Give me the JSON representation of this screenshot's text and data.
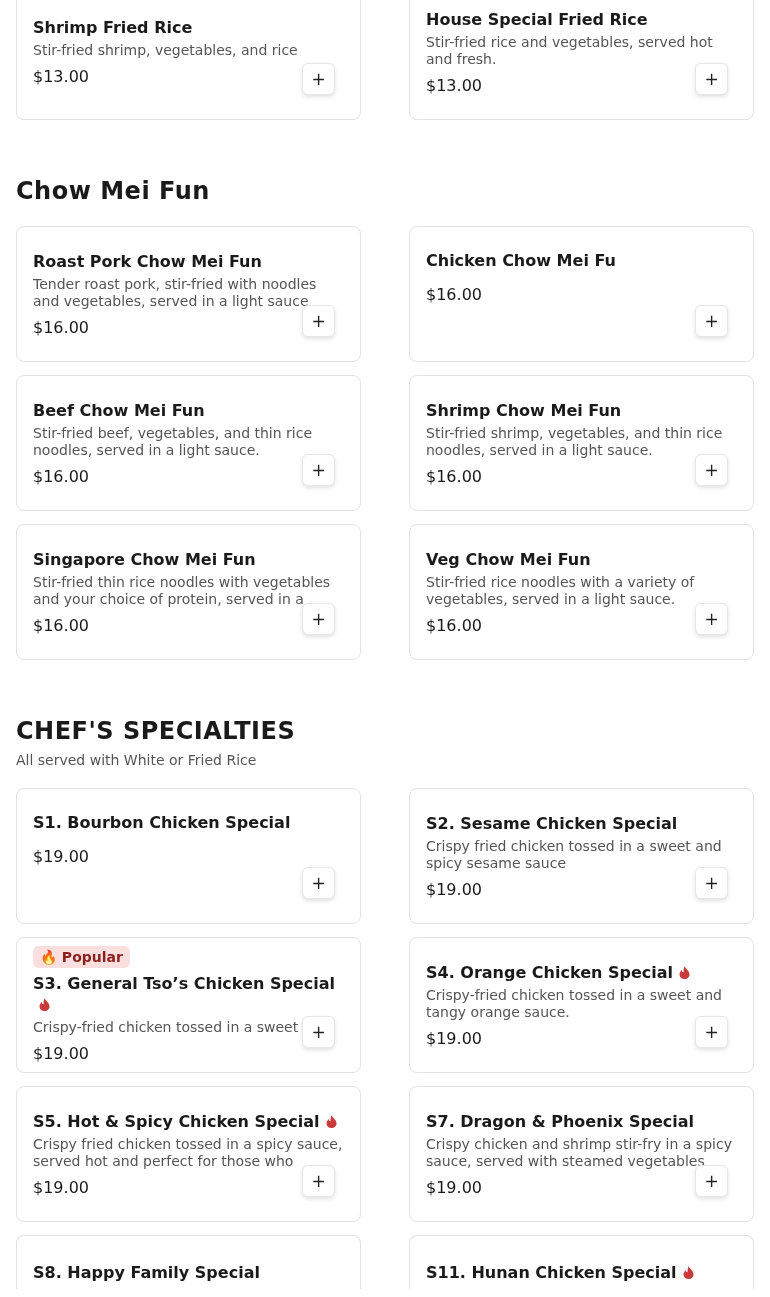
{
  "sections": [
    {
      "items": [
        {
          "name": "Shrimp Fried Rice",
          "description": "Stir-fried shrimp, vegetables, and rice",
          "price": "$13.00",
          "spicy": false,
          "add": "+"
        },
        {
          "name": "House Special Fried Rice",
          "description": "Stir-fried rice and vegetables, served hot and fresh.",
          "price": "$13.00",
          "spicy": false,
          "add": "+"
        }
      ]
    },
    {
      "title": "Chow Mei Fun",
      "items": [
        {
          "name": "Roast Pork Chow Mei Fun",
          "description": "Tender roast pork, stir-fried with noodles and vegetables, served in a light sauce",
          "price": "$16.00",
          "spicy": false,
          "add": "+"
        },
        {
          "name": "Chicken Chow Mei Fu",
          "price": "$16.00",
          "spicy": false,
          "add": "+"
        },
        {
          "name": "Beef Chow Mei Fun",
          "description": "Stir-fried beef, vegetables, and thin rice noodles, served in a light sauce.",
          "price": "$16.00",
          "spicy": false,
          "add": "+"
        },
        {
          "name": "Shrimp Chow Mei Fun",
          "description": "Stir-fried shrimp, vegetables, and thin rice noodles, served in a light sauce.",
          "price": "$16.00",
          "spicy": false,
          "add": "+"
        },
        {
          "name": "Singapore Chow Mei Fun",
          "description": "Stir-fried thin rice noodles with vegetables and your choice of protein, served in a",
          "price": "$16.00",
          "spicy": false,
          "add": "+"
        },
        {
          "name": "Veg Chow Mei Fun",
          "description": "Stir-fried rice noodles with a variety of vegetables, served in a light sauce.",
          "price": "$16.00",
          "spicy": false,
          "add": "+"
        }
      ]
    },
    {
      "title": "CHEF'S SPECIALTIES",
      "subtitle": "All served with White or Fried Rice",
      "items": [
        {
          "name": "S1. Bourbon Chicken Special",
          "price": "$19.00",
          "spicy": false,
          "add": "+"
        },
        {
          "name": "S2. Sesame Chicken Special",
          "description": "Crispy fried chicken tossed in a sweet and spicy sesame sauce",
          "price": "$19.00",
          "spicy": false,
          "add": "+"
        },
        {
          "badge": "🔥 Popular",
          "name": "S3. General Tso’s Chicken Special",
          "description": "Crispy-fried chicken tossed in a sweet",
          "price": "$19.00",
          "spicy": true,
          "add": "+"
        },
        {
          "name": "S4. Orange Chicken Special",
          "description": "Crispy-fried chicken tossed in a sweet and tangy orange sauce.",
          "price": "$19.00",
          "spicy": true,
          "add": "+"
        },
        {
          "name": "S5. Hot & Spicy Chicken Special",
          "description": "Crispy fried chicken tossed in a spicy sauce, served hot and perfect for those who",
          "price": "$19.00",
          "spicy": true,
          "add": "+"
        },
        {
          "name": "S7. Dragon & Phoenix Special",
          "description": "Crispy chicken and shrimp stir-fry in a spicy sauce, served with steamed vegetables",
          "price": "$19.00",
          "spicy": false,
          "add": "+"
        },
        {
          "name": "S8. Happy Family Special",
          "spicy": false
        },
        {
          "name": "S11. Hunan Chicken Special",
          "spicy": true
        }
      ]
    }
  ]
}
